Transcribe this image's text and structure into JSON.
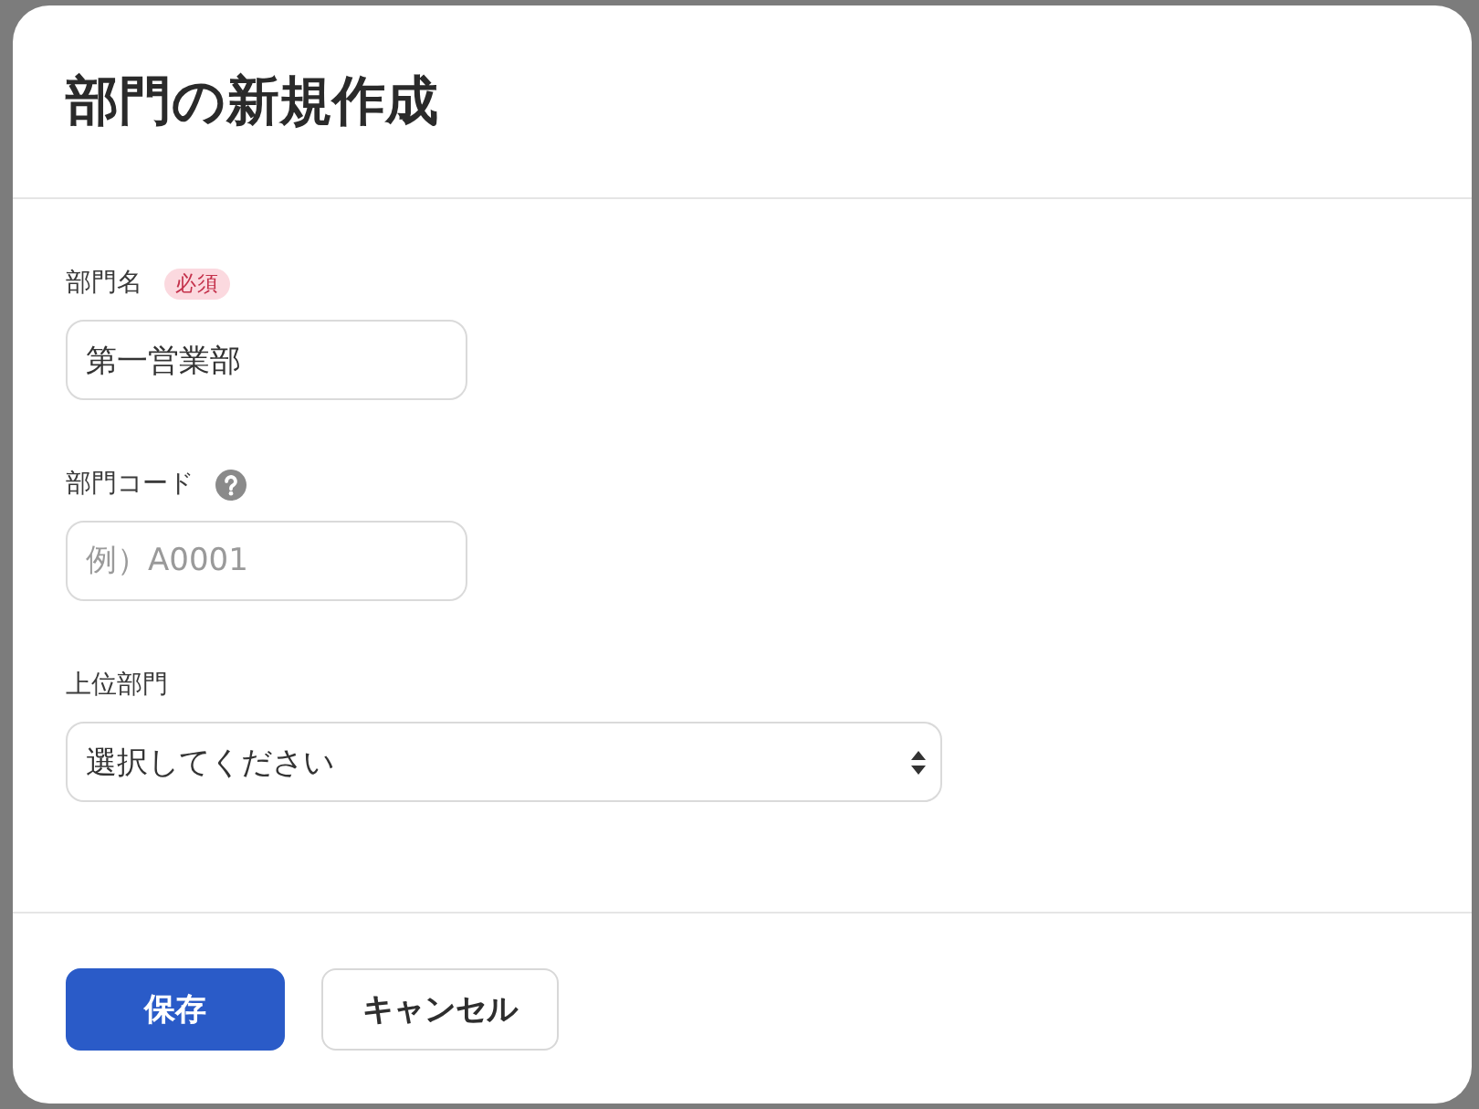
{
  "dialog": {
    "title": "部門の新規作成"
  },
  "fields": [
    {
      "kind": "text",
      "label": "部門名",
      "badge": "必須",
      "value": "第一営業部"
    },
    {
      "kind": "text",
      "label": "部門コード",
      "help": true,
      "placeholder": "例）A0001"
    },
    {
      "kind": "select",
      "label": "上位部門",
      "value": "選択してください"
    }
  ],
  "buttons": [
    {
      "kind": "primary",
      "label": "保存"
    },
    {
      "kind": "secondary",
      "label": "キャンセル"
    }
  ]
}
